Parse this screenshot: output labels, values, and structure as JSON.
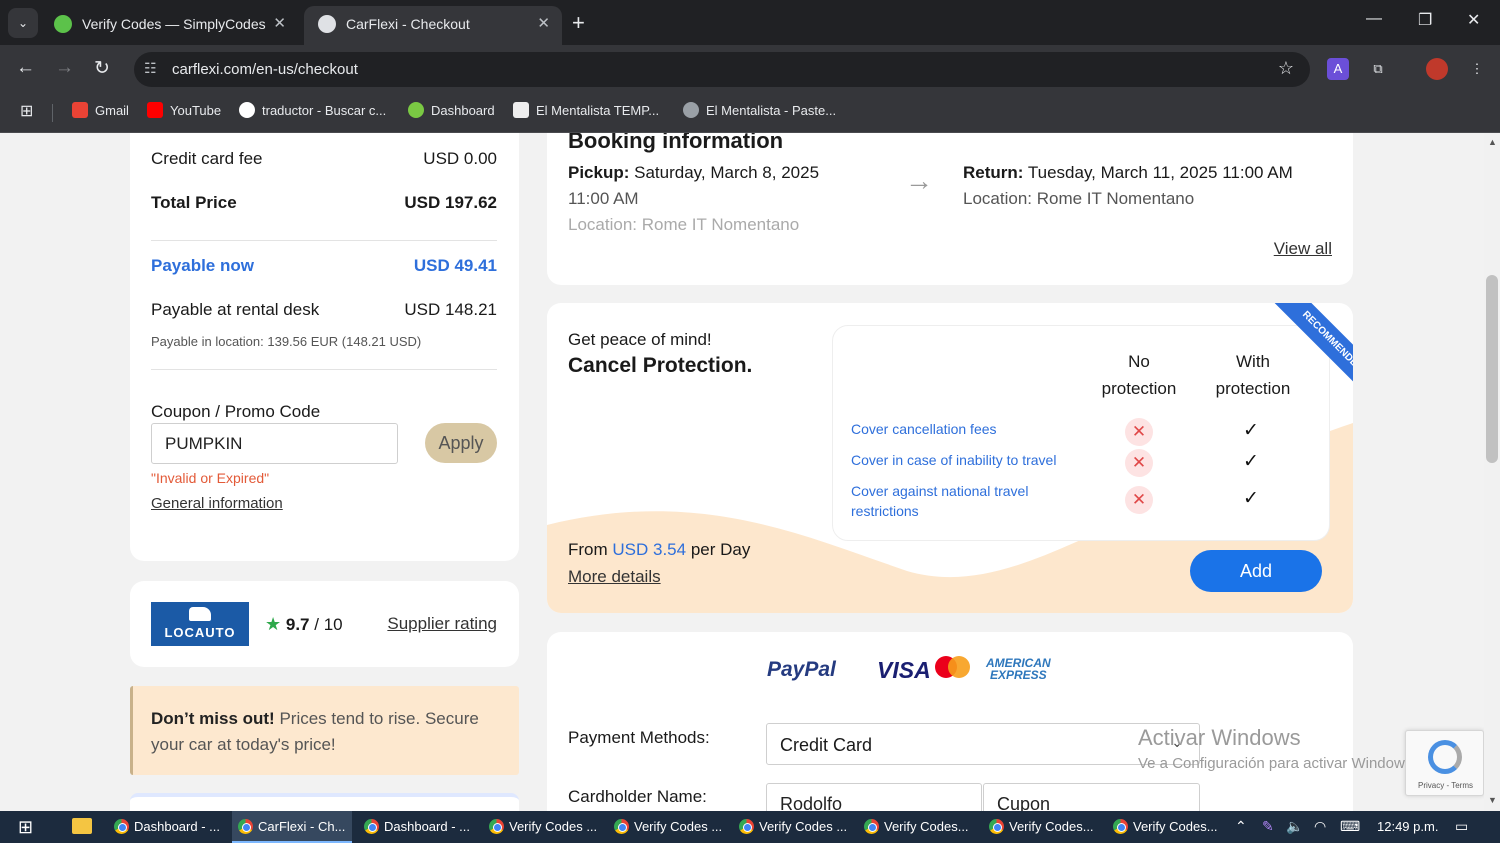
{
  "browser": {
    "tabs": [
      {
        "title": "Verify Codes — SimplyCodes",
        "active": false
      },
      {
        "title": "CarFlexi - Checkout",
        "active": true
      }
    ],
    "url": "carflexi.com/en-us/checkout",
    "bookmarks": [
      "Gmail",
      "YouTube",
      "traductor - Buscar c...",
      "Dashboard",
      "El Mentalista TEMP...",
      "El Mentalista - Paste..."
    ]
  },
  "summary": {
    "credit_card_fee_label": "Credit card fee",
    "credit_card_fee_value": "USD 0.00",
    "total_price_label": "Total Price",
    "total_price_value": "USD 197.62",
    "payable_now_label": "Payable now",
    "payable_now_value": "USD 49.41",
    "payable_desk_label": "Payable at rental desk",
    "payable_desk_value": "USD 148.21",
    "payable_location_note": "Payable in location: 139.56 EUR (148.21 USD)",
    "coupon_label": "Coupon / Promo Code",
    "coupon_value": "PUMPKIN",
    "apply_label": "Apply",
    "coupon_error": "\"Invalid or Expired\"",
    "general_info": "General information"
  },
  "supplier": {
    "logo_text": "LOCAUTO",
    "rating": "9.7",
    "rating_max": "/ 10",
    "rating_link": "Supplier rating"
  },
  "promo": {
    "bold": "Don’t miss out!",
    "text": " Prices tend to rise. Secure your car at today's price!"
  },
  "booking": {
    "title": "Booking information",
    "pickup_label": "Pickup:",
    "pickup_date": " Saturday, March 8, 2025",
    "pickup_time": "11:00 AM",
    "pickup_location": "Location: Rome IT Nomentano",
    "return_label": "Return:",
    "return_date": " Tuesday, March 11, 2025 11:00 AM",
    "return_location": "Location: Rome IT Nomentano",
    "view_all": "View all"
  },
  "protection": {
    "peace": "Get peace of mind!",
    "title": "Cancel Protection.",
    "col_no": "No protection",
    "col_with": "With protection",
    "ribbon": "RECOMMENDED",
    "features": [
      "Cover cancellation fees",
      "Cover in case of inability to travel",
      "Cover against national travel restrictions"
    ],
    "from_label": "From ",
    "price": "USD 3.54",
    "per_day": " per Day",
    "more_details": "More details",
    "add_label": "Add"
  },
  "payment": {
    "logos": [
      "PayPal",
      "VISA",
      "mastercard",
      "AMERICAN EXPRESS"
    ],
    "methods_label": "Payment Methods:",
    "method_value": "Credit Card",
    "cardholder_label": "Cardholder Name:",
    "first_name": "Rodolfo",
    "last_name": "Cupon"
  },
  "windows_watermark": {
    "line1": "Activar Windows",
    "line2": "Ve a Configuración para activar Windows."
  },
  "recaptcha": {
    "text": "Privacy - Terms"
  },
  "taskbar": {
    "items": [
      "Dashboard - ...",
      "CarFlexi - Ch...",
      "Dashboard - ...",
      "Verify Codes ...",
      "Verify Codes ...",
      "Verify Codes ...",
      "Verify Codes...",
      "Verify Codes...",
      "Verify Codes..."
    ],
    "clock": "12:49 p.m."
  },
  "colors": {
    "accent": "#1a73e8",
    "link_blue": "#2e6fdb",
    "error": "#e35a38",
    "promo_bg": "#fde8cf"
  }
}
